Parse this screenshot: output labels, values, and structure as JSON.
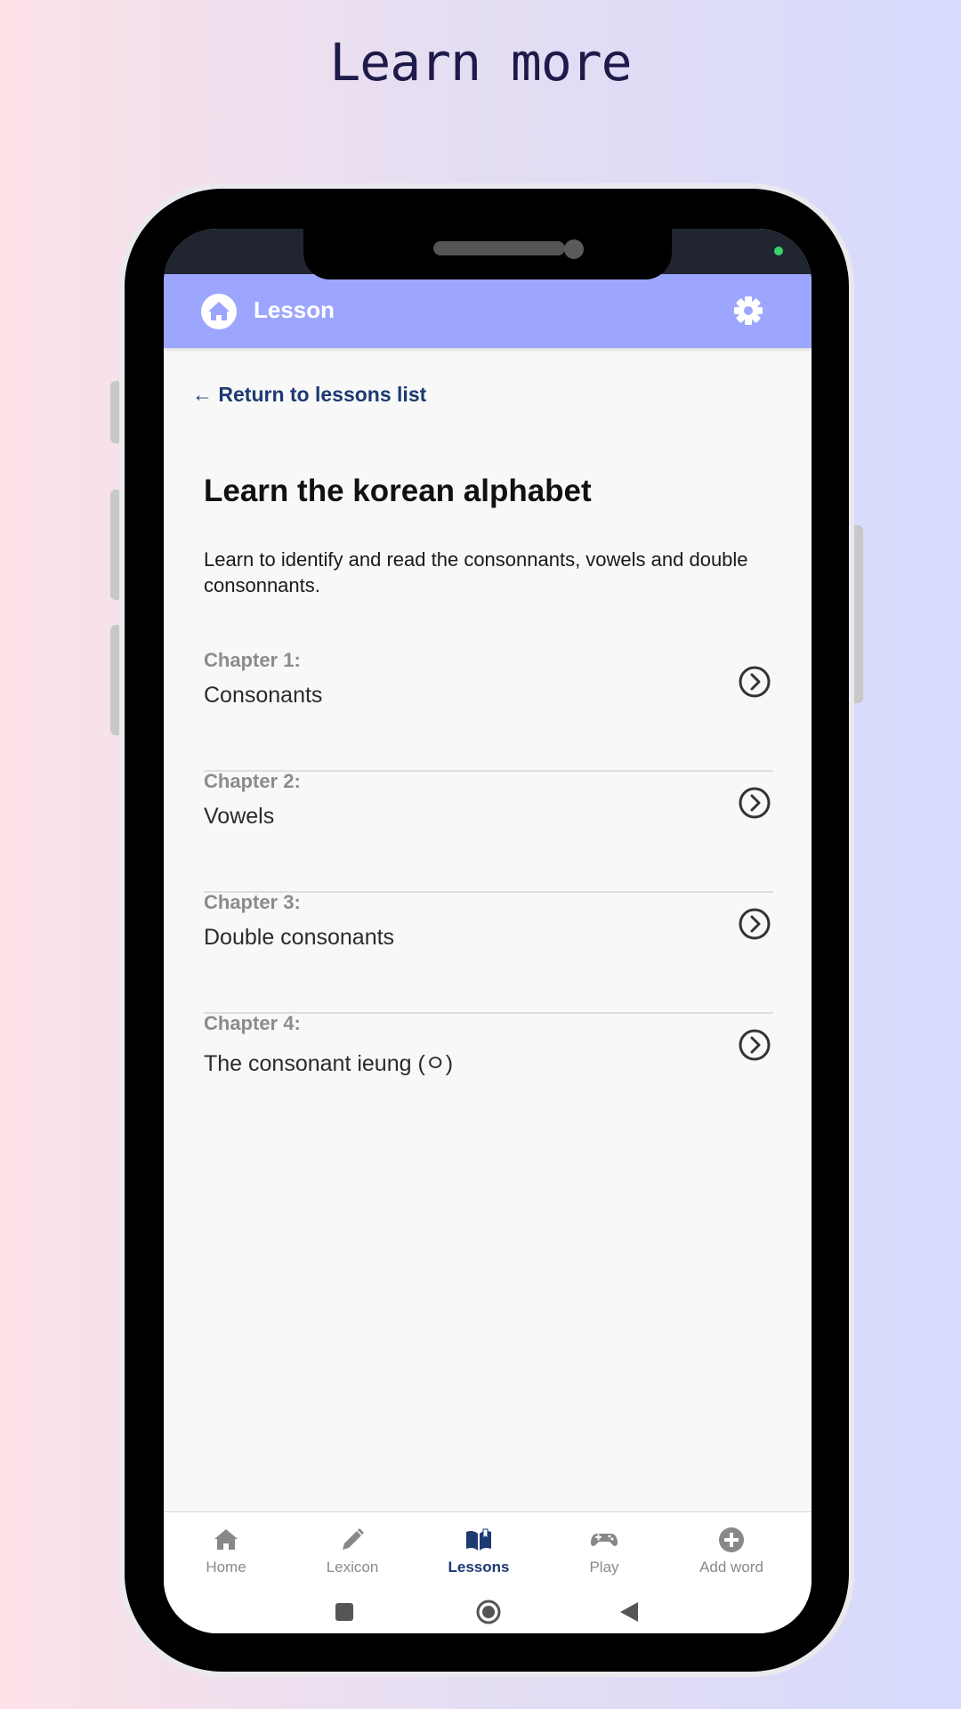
{
  "promo": {
    "title": "Learn more"
  },
  "appbar": {
    "title": "Lesson"
  },
  "back_link": "← Return to lessons list",
  "lesson": {
    "title": "Learn the korean alphabet",
    "description": "Learn to identify and read the consonnants, vowels and double consonnants."
  },
  "chapters": [
    {
      "label": "Chapter 1:",
      "name": "Consonants"
    },
    {
      "label": "Chapter 2:",
      "name": "Vowels"
    },
    {
      "label": "Chapter 3:",
      "name": "Double consonants"
    },
    {
      "label": "Chapter 4:",
      "name": "The consonant ieung (ㅇ)"
    }
  ],
  "bottom_nav": {
    "items": [
      {
        "label": "Home",
        "icon": "home-icon"
      },
      {
        "label": "Lexicon",
        "icon": "pencil-icon"
      },
      {
        "label": "Lessons",
        "icon": "book-icon",
        "active": true
      },
      {
        "label": "Play",
        "icon": "gamepad-icon"
      },
      {
        "label": "Add word",
        "icon": "plus-circle-icon"
      }
    ]
  },
  "colors": {
    "appbar": "#9ca6fe",
    "accent": "#1d3a72",
    "status_bar": "#202531"
  }
}
